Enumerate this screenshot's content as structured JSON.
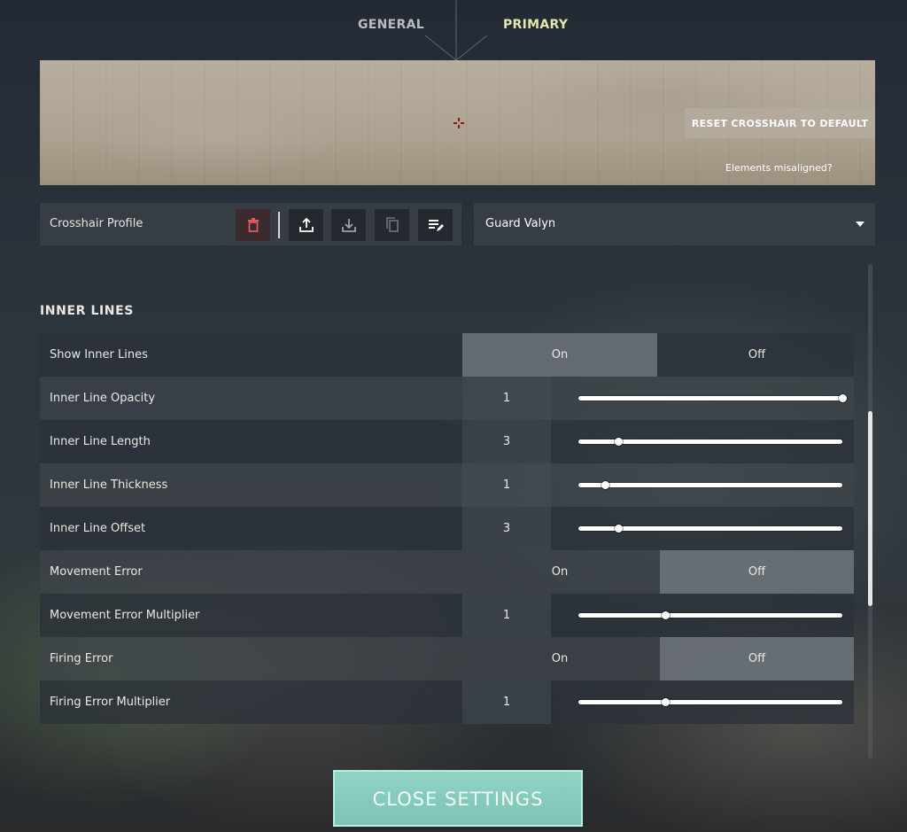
{
  "tabs": {
    "general": "GENERAL",
    "primary": "PRIMARY"
  },
  "preview": {
    "reset_label": "RESET CROSSHAIR TO DEFAULT",
    "misaligned_link": "Elements misaligned?",
    "crosshair_color": "#8a1a1a"
  },
  "profile": {
    "label": "Crosshair Profile",
    "selected": "Guard Valyn"
  },
  "section": {
    "title": "INNER LINES"
  },
  "rows": {
    "show_inner_lines": {
      "label": "Show Inner Lines",
      "on": "On",
      "off": "Off",
      "selected": "On"
    },
    "inner_line_opacity": {
      "label": "Inner Line Opacity",
      "value": "1",
      "slider_fraction": 1.0
    },
    "inner_line_length": {
      "label": "Inner Line Length",
      "value": "3",
      "slider_fraction": 0.15
    },
    "inner_line_thickness": {
      "label": "Inner Line Thickness",
      "value": "1",
      "slider_fraction": 0.1
    },
    "inner_line_offset": {
      "label": "Inner Line Offset",
      "value": "3",
      "slider_fraction": 0.15
    },
    "movement_error": {
      "label": "Movement Error",
      "on": "On",
      "off": "Off",
      "selected": "Off"
    },
    "movement_error_multiplier": {
      "label": "Movement Error Multiplier",
      "value": "1",
      "slider_fraction": 0.33
    },
    "firing_error": {
      "label": "Firing Error",
      "on": "On",
      "off": "Off",
      "selected": "Off"
    },
    "firing_error_multiplier": {
      "label": "Firing Error Multiplier",
      "value": "1",
      "slider_fraction": 0.33
    }
  },
  "footer": {
    "close_label": "CLOSE SETTINGS"
  },
  "colors": {
    "accent": "#7cc4b6",
    "delete_icon": "#e0595f"
  }
}
